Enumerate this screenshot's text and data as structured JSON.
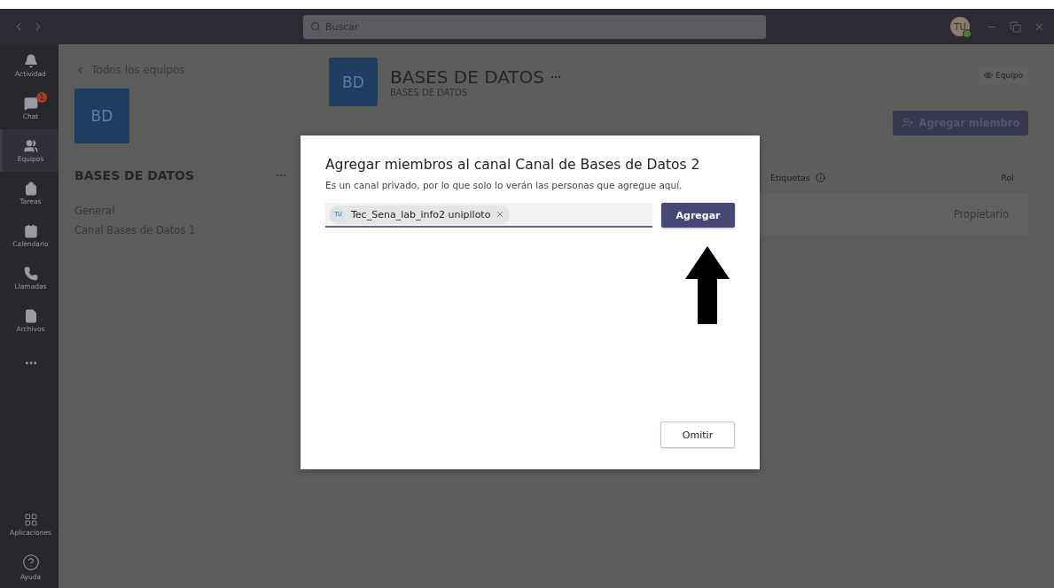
{
  "titlebar": {
    "search_placeholder": "Buscar",
    "avatar": "TU",
    "online": true
  },
  "rail": {
    "items": [
      {
        "kind": "bell",
        "label": "Actividad",
        "selected": false
      },
      {
        "kind": "chat",
        "label": "Chat",
        "selected": false,
        "badge": "1"
      },
      {
        "kind": "teams",
        "label": "Equipos",
        "selected": true
      },
      {
        "kind": "tasks",
        "label": "Tareas",
        "selected": false
      },
      {
        "kind": "calendar",
        "label": "Calendario",
        "selected": false
      },
      {
        "kind": "calls",
        "label": "Llamadas",
        "selected": false
      },
      {
        "kind": "files",
        "label": "Archivos",
        "selected": false
      },
      {
        "kind": "more",
        "selected": false
      }
    ],
    "bottom_items": [
      {
        "kind": "apps",
        "label": "Aplicaciones",
        "selected": false
      },
      {
        "kind": "help",
        "label": "Ayuda",
        "selected": false
      }
    ]
  },
  "team_panel": {
    "back_link": "Todos los equipos",
    "avatar": "BD",
    "team_name": "BASES DE DATOS",
    "channels": [
      {
        "name": "General",
        "selected": false
      },
      {
        "name": "Canal Bases de Datos 1",
        "selected": false
      }
    ]
  },
  "main": {
    "avatar": "BD",
    "title": "BASES DE DATOS",
    "subtitle": "BASES DE DATOS",
    "team_badge": "Equipo",
    "add_member_button": "Agregar miembro",
    "columns": [
      "Etiquetas",
      "Rol"
    ],
    "rows": [
      {
        "role": "Propietario"
      }
    ]
  },
  "dialog": {
    "title": "Agregar miembros al canal Canal de Bases de Datos 2",
    "description": "Es un canal privado, por lo que solo lo verán las personas que agregue aquí.",
    "chips": [
      {
        "initials": "TU",
        "name": "Tec_Sena_lab_info2 unipiloto"
      }
    ],
    "add_button": "Agregar",
    "skip_button": "Omitir"
  }
}
